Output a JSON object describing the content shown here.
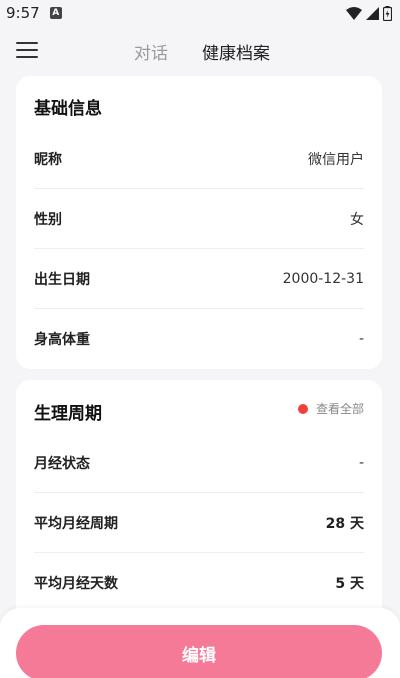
{
  "status_bar": {
    "time": "9:57",
    "badge": "A"
  },
  "header": {
    "tabs": [
      {
        "label": "对话"
      },
      {
        "label": "健康档案"
      }
    ]
  },
  "basic_info": {
    "title": "基础信息",
    "rows": [
      {
        "label": "昵称",
        "value": "微信用户"
      },
      {
        "label": "性别",
        "value": "女"
      },
      {
        "label": "出生日期",
        "value": "2000-12-31"
      },
      {
        "label": "身高体重",
        "value": "-"
      }
    ]
  },
  "cycle": {
    "title": "生理周期",
    "view_all": "查看全部",
    "rows": [
      {
        "label": "月经状态",
        "value": "-"
      },
      {
        "label": "平均月经周期",
        "value": "28 天"
      },
      {
        "label": "平均月经天数",
        "value": "5 天"
      }
    ]
  },
  "footer": {
    "edit_label": "编辑"
  },
  "colors": {
    "accent": "#f47a97",
    "dot": "#f0403a",
    "background": "#f5f5f7"
  },
  "icons": {
    "menu": "hamburger-icon",
    "wifi": "wifi-icon",
    "signal": "signal-icon",
    "battery": "battery-icon"
  }
}
